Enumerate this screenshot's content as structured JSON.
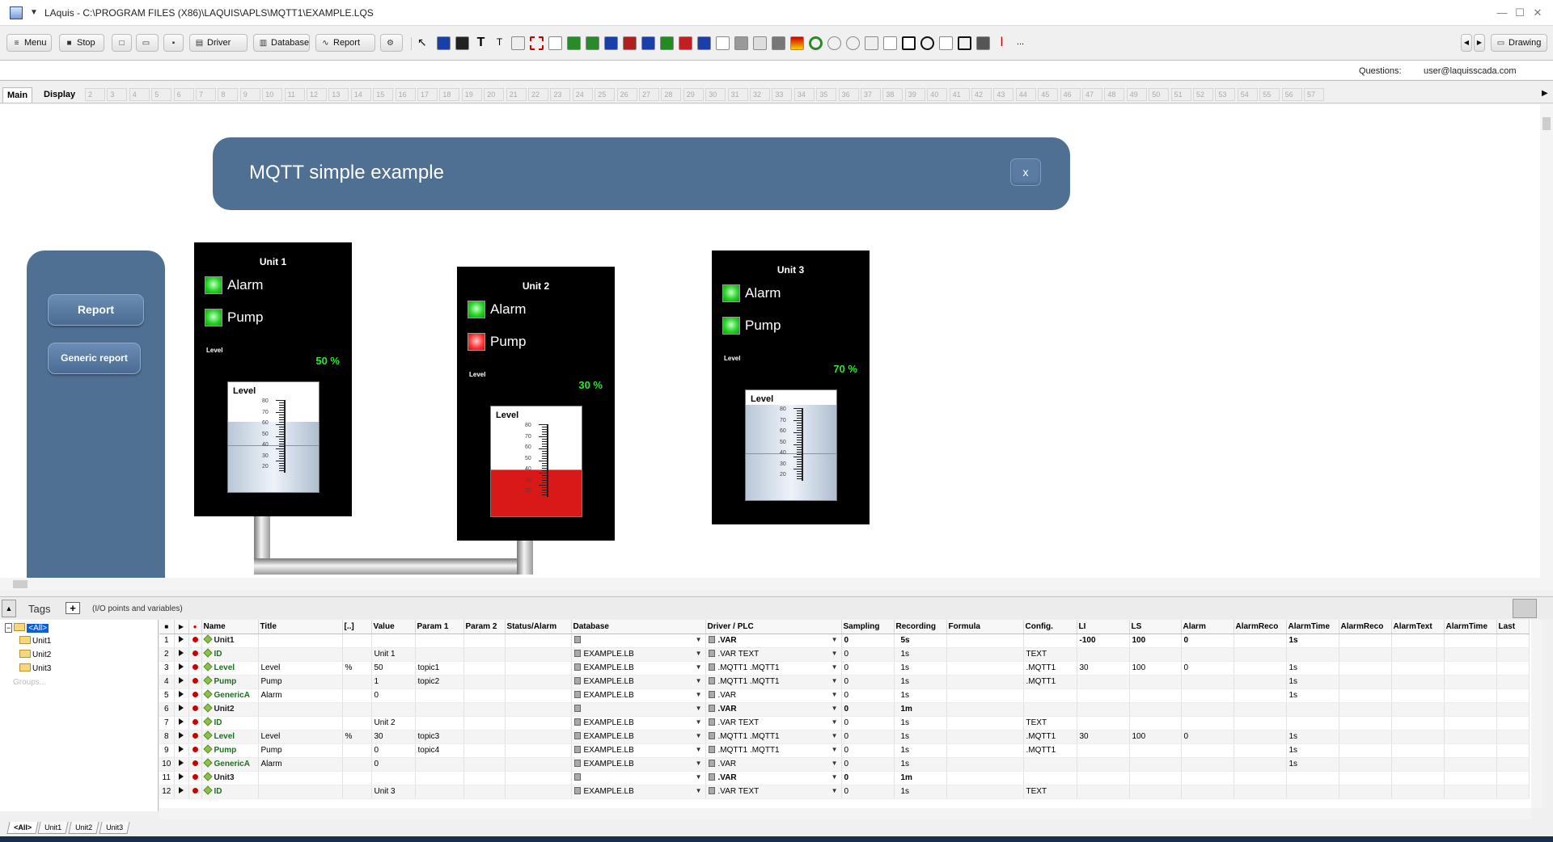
{
  "window": {
    "title": "LAquis - C:\\PROGRAM FILES (X86)\\LAQUIS\\APLS\\MQTT1\\EXAMPLE.LQS"
  },
  "toolbar": {
    "menu_label": "Menu",
    "stop_label": "Stop",
    "driver_label": "Driver",
    "database_label": "Database",
    "report_label": "Report",
    "drawing_label": "Drawing",
    "more_label": "..."
  },
  "info": {
    "questions_label": "Questions:",
    "email": "user@laquisscada.com"
  },
  "tabs": {
    "main": "Main",
    "display": "Display",
    "numbers": [
      "2",
      "3",
      "4",
      "5",
      "6",
      "7",
      "8",
      "9",
      "10",
      "11",
      "12",
      "13",
      "14",
      "15",
      "16",
      "17",
      "18",
      "19",
      "20",
      "21",
      "22",
      "23",
      "24",
      "25",
      "26",
      "27",
      "28",
      "29",
      "30",
      "31",
      "32",
      "33",
      "34",
      "35",
      "36",
      "37",
      "38",
      "39",
      "40",
      "41",
      "42",
      "43",
      "44",
      "45",
      "46",
      "47",
      "48",
      "49",
      "50",
      "51",
      "52",
      "53",
      "54",
      "55",
      "56",
      "57"
    ]
  },
  "screen": {
    "title": "MQTT simple example",
    "close_label": "x",
    "report_button": "Report",
    "generic_report_button": "Generic report"
  },
  "units": [
    {
      "title": "Unit 1",
      "alarm_label": "Alarm",
      "pump_label": "Pump",
      "alarm_state": "green",
      "pump_state": "green",
      "level_small": "Level",
      "percent_text": "50 %",
      "gauge_label": "Level",
      "level": 50,
      "fill_color": "blue"
    },
    {
      "title": "Unit 2",
      "alarm_label": "Alarm",
      "pump_label": "Pump",
      "alarm_state": "green",
      "pump_state": "red",
      "level_small": "Level",
      "percent_text": "30 %",
      "gauge_label": "Level",
      "level": 30,
      "fill_color": "red"
    },
    {
      "title": "Unit 3",
      "alarm_label": "Alarm",
      "pump_label": "Pump",
      "alarm_state": "green",
      "pump_state": "green",
      "level_small": "Level",
      "percent_text": "70 %",
      "gauge_label": "Level",
      "level": 70,
      "fill_color": "blue"
    }
  ],
  "gauge_ticks": [
    "80",
    "70",
    "60",
    "50",
    "40",
    "30",
    "20"
  ],
  "tags": {
    "title": "Tags",
    "add_label": "+",
    "subtitle": "(I/O points and variables)",
    "tree": {
      "all": "<All>",
      "items": [
        "Unit1",
        "Unit2",
        "Unit3"
      ],
      "groups": "Groups..."
    },
    "columns": [
      "■",
      "▶",
      "●",
      "Name",
      "Title",
      "[..]",
      "Value",
      "Param 1",
      "Param 2",
      "Status/Alarm",
      "Database",
      "Driver / PLC",
      "Sampling",
      "Recording",
      "Formula",
      "Config.",
      "LI",
      "LS",
      "Alarm",
      "AlarmReco",
      "AlarmTime",
      "AlarmReco",
      "AlarmText",
      "AlarmTime",
      "Last"
    ],
    "rows": [
      {
        "n": "1",
        "name": "Unit1",
        "kind": "unit",
        "title": "",
        "unit": "",
        "value": "",
        "p1": "",
        "db": "",
        "drv": ".VAR",
        "samp": "0",
        "rec": "5s",
        "cfg": "",
        "li": "-100",
        "ls": "100",
        "alarm": "0",
        "atime": "1s"
      },
      {
        "n": "2",
        "name": "ID",
        "kind": "tag",
        "title": "",
        "unit": "",
        "value": "Unit 1",
        "p1": "",
        "db": "EXAMPLE.LB",
        "drv": ".VAR TEXT",
        "samp": "0",
        "rec": "1s",
        "cfg": "TEXT",
        "li": "",
        "ls": "",
        "alarm": "",
        "atime": ""
      },
      {
        "n": "3",
        "name": "Level",
        "kind": "tag",
        "title": "Level",
        "unit": "%",
        "value": "50",
        "p1": "topic1",
        "db": "EXAMPLE.LB",
        "drv": ".MQTT1 .MQTT1",
        "samp": "0",
        "rec": "1s",
        "cfg": ".MQTT1",
        "li": "30",
        "ls": "100",
        "alarm": "0",
        "atime": "1s"
      },
      {
        "n": "4",
        "name": "Pump",
        "kind": "tag",
        "title": "Pump",
        "unit": "",
        "value": "1",
        "p1": "topic2",
        "db": "EXAMPLE.LB",
        "drv": ".MQTT1 .MQTT1",
        "samp": "0",
        "rec": "1s",
        "cfg": ".MQTT1",
        "li": "",
        "ls": "",
        "alarm": "",
        "atime": "1s"
      },
      {
        "n": "5",
        "name": "GenericA",
        "kind": "tag",
        "title": "Alarm",
        "unit": "",
        "value": "0",
        "p1": "",
        "db": "EXAMPLE.LB",
        "drv": ".VAR",
        "samp": "0",
        "rec": "1s",
        "cfg": "",
        "li": "",
        "ls": "",
        "alarm": "",
        "atime": "1s"
      },
      {
        "n": "6",
        "name": "Unit2",
        "kind": "unit",
        "title": "",
        "unit": "",
        "value": "",
        "p1": "",
        "db": "",
        "drv": ".VAR",
        "samp": "0",
        "rec": "1m",
        "cfg": "",
        "li": "",
        "ls": "",
        "alarm": "",
        "atime": ""
      },
      {
        "n": "7",
        "name": "ID",
        "kind": "tag",
        "title": "",
        "unit": "",
        "value": "Unit 2",
        "p1": "",
        "db": "EXAMPLE.LB",
        "drv": ".VAR TEXT",
        "samp": "0",
        "rec": "1s",
        "cfg": "TEXT",
        "li": "",
        "ls": "",
        "alarm": "",
        "atime": ""
      },
      {
        "n": "8",
        "name": "Level",
        "kind": "tag",
        "title": "Level",
        "unit": "%",
        "value": "30",
        "p1": "topic3",
        "db": "EXAMPLE.LB",
        "drv": ".MQTT1 .MQTT1",
        "samp": "0",
        "rec": "1s",
        "cfg": ".MQTT1",
        "li": "30",
        "ls": "100",
        "alarm": "0",
        "atime": "1s"
      },
      {
        "n": "9",
        "name": "Pump",
        "kind": "tag",
        "title": "Pump",
        "unit": "",
        "value": "0",
        "p1": "topic4",
        "db": "EXAMPLE.LB",
        "drv": ".MQTT1 .MQTT1",
        "samp": "0",
        "rec": "1s",
        "cfg": ".MQTT1",
        "li": "",
        "ls": "",
        "alarm": "",
        "atime": "1s"
      },
      {
        "n": "10",
        "name": "GenericA",
        "kind": "tag",
        "title": "Alarm",
        "unit": "",
        "value": "0",
        "p1": "",
        "db": "EXAMPLE.LB",
        "drv": ".VAR",
        "samp": "0",
        "rec": "1s",
        "cfg": "",
        "li": "",
        "ls": "",
        "alarm": "",
        "atime": "1s"
      },
      {
        "n": "11",
        "name": "Unit3",
        "kind": "unit",
        "title": "",
        "unit": "",
        "value": "",
        "p1": "",
        "db": "",
        "drv": ".VAR",
        "samp": "0",
        "rec": "1m",
        "cfg": "",
        "li": "",
        "ls": "",
        "alarm": "",
        "atime": ""
      },
      {
        "n": "12",
        "name": "ID",
        "kind": "tag",
        "title": "",
        "unit": "",
        "value": "Unit 3",
        "p1": "",
        "db": "EXAMPLE.LB",
        "drv": ".VAR TEXT",
        "samp": "0",
        "rec": "1s",
        "cfg": "TEXT",
        "li": "",
        "ls": "",
        "alarm": "",
        "atime": ""
      }
    ]
  },
  "bottom_tabs": [
    "<All>",
    "Unit1",
    "Unit2",
    "Unit3"
  ]
}
